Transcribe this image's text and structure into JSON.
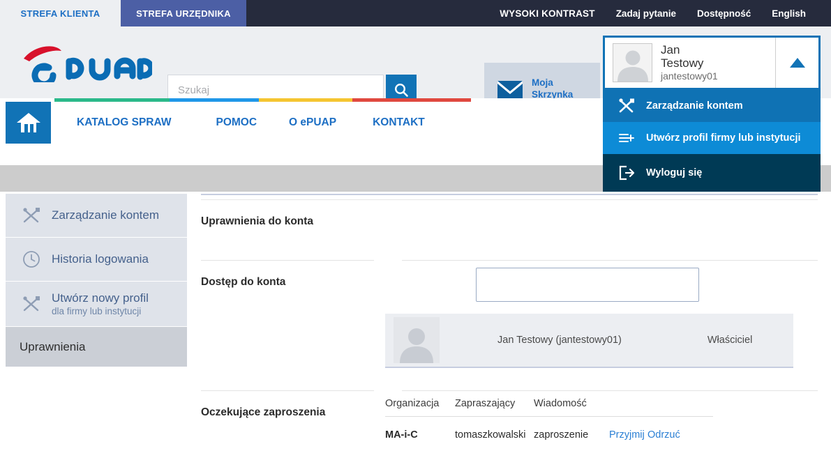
{
  "topbar": {
    "zones": [
      {
        "label": "STREFA KLIENTA",
        "active": true
      },
      {
        "label": "STREFA URZĘDNIKA",
        "active": false
      }
    ],
    "links": [
      {
        "label": "WYSOKI KONTRAST",
        "name": "high-contrast-link"
      },
      {
        "label": "Zadaj pytanie",
        "name": "ask-question-link"
      },
      {
        "label": "Dostępność",
        "name": "accessibility-link"
      },
      {
        "label": "English",
        "name": "english-link"
      }
    ]
  },
  "header": {
    "logo_text": "ePUAP",
    "search": {
      "placeholder": "Szukaj",
      "value": "",
      "icon": "search-icon"
    },
    "mailbox": {
      "line1": "Moja",
      "line2": "Skrzynka",
      "icon": "envelope-icon"
    },
    "user": {
      "first_name": "Jan",
      "last_name": "Testowy",
      "login": "jantestowy01",
      "avatar_icon": "user-avatar-icon",
      "caret_icon": "triangle-up-icon"
    },
    "user_menu": [
      {
        "label": "Zarządzanie kontem",
        "icon": "tools-icon",
        "name": "menu-item-account-management"
      },
      {
        "label": "Utwórz profil firmy lub instytucji",
        "icon": "list-plus-icon",
        "name": "menu-item-create-company-profile"
      },
      {
        "label": "Wyloguj się",
        "icon": "logout-icon",
        "name": "menu-item-logout"
      }
    ]
  },
  "nav": {
    "home_icon": "home-icon",
    "stripe_colors": [
      "#2bb98a",
      "#1f97e8",
      "#f5c531",
      "#e0483f"
    ],
    "items": [
      {
        "label": "KATALOG SPRAW",
        "name": "nav-katalog-spraw"
      },
      {
        "label": "POMOC",
        "name": "nav-pomoc"
      },
      {
        "label": "O ePUAP",
        "name": "nav-o-epuap"
      },
      {
        "label": "KONTAKT",
        "name": "nav-kontakt"
      }
    ]
  },
  "sidebar": {
    "items": [
      {
        "label": "Zarządzanie kontem",
        "sub": "",
        "icon": "tools-icon",
        "active": false
      },
      {
        "label": "Historia logowania",
        "sub": "",
        "icon": "clock-icon",
        "active": false
      },
      {
        "label": "Utwórz nowy profil",
        "sub": "dla firmy lub instytucji",
        "icon": "tools-icon",
        "active": false
      },
      {
        "label": "Uprawnienia",
        "sub": "",
        "icon": "",
        "active": true
      }
    ]
  },
  "main": {
    "sections": [
      {
        "title": "Uprawnienia do konta"
      },
      {
        "title": "Dostęp do konta"
      },
      {
        "title": "Oczekujące zaproszenia"
      }
    ],
    "access": {
      "add_input_value": "",
      "members": [
        {
          "name": "Jan Testowy (jantestowy01)",
          "role": "Właściciel",
          "avatar_icon": "user-avatar-icon"
        }
      ]
    },
    "invitations": {
      "columns": [
        "Organizacja",
        "Zapraszający",
        "Wiadomość"
      ],
      "rows": [
        {
          "organization": "MA-i-C",
          "inviter": "tomaszkowalski",
          "message": "zaproszenie",
          "accept_label": "Przyjmij",
          "reject_label": "Odrzuć"
        }
      ]
    }
  },
  "colors": {
    "brand_blue": "#1173b6",
    "dark_navy": "#262b3d",
    "menu_mid": "#0d8bd6",
    "menu_dark": "#003a55",
    "link_blue": "#1d6fc4",
    "gray_band": "#cccccc",
    "sidebar_bg": "#dfe3ea",
    "sidebar_active": "#cbcfd6"
  }
}
